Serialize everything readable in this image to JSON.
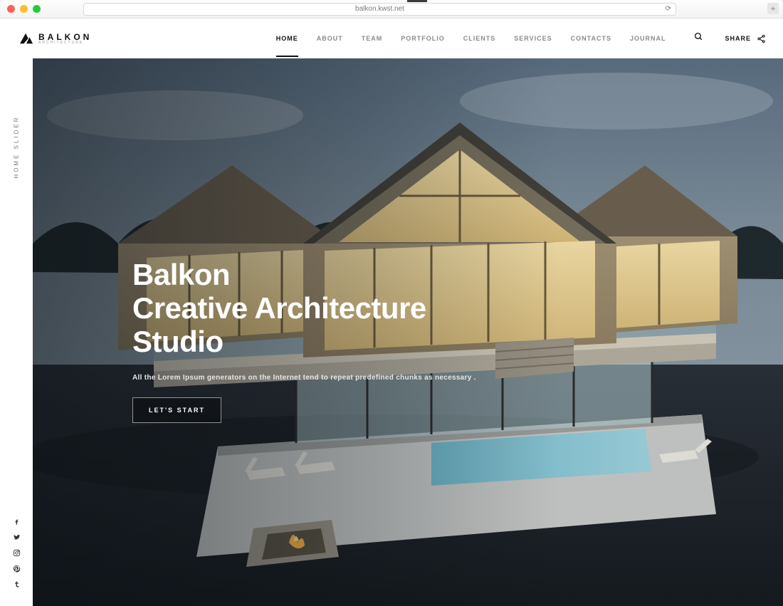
{
  "browser": {
    "url": "balkon.kwst.net"
  },
  "logo": {
    "text": "BALKON",
    "sub": "ARCHITECTURE"
  },
  "nav": {
    "items": [
      "HOME",
      "ABOUT",
      "TEAM",
      "PORTFOLIO",
      "CLIENTS",
      "SERVICES",
      "CONTACTS",
      "JOURNAL"
    ],
    "active": 0,
    "share": "SHARE"
  },
  "rail": {
    "label": "HOME SLIDER"
  },
  "hero": {
    "line1": "Balkon",
    "line2": "Creative Architecture",
    "line3": "Studio",
    "sub": "All the Lorem Ipsum generators on the Internet tend to repeat predefined chunks as necessary .",
    "cta": "LET'S START"
  },
  "social_icons": [
    "facebook",
    "twitter",
    "instagram",
    "pinterest",
    "tumblr"
  ]
}
